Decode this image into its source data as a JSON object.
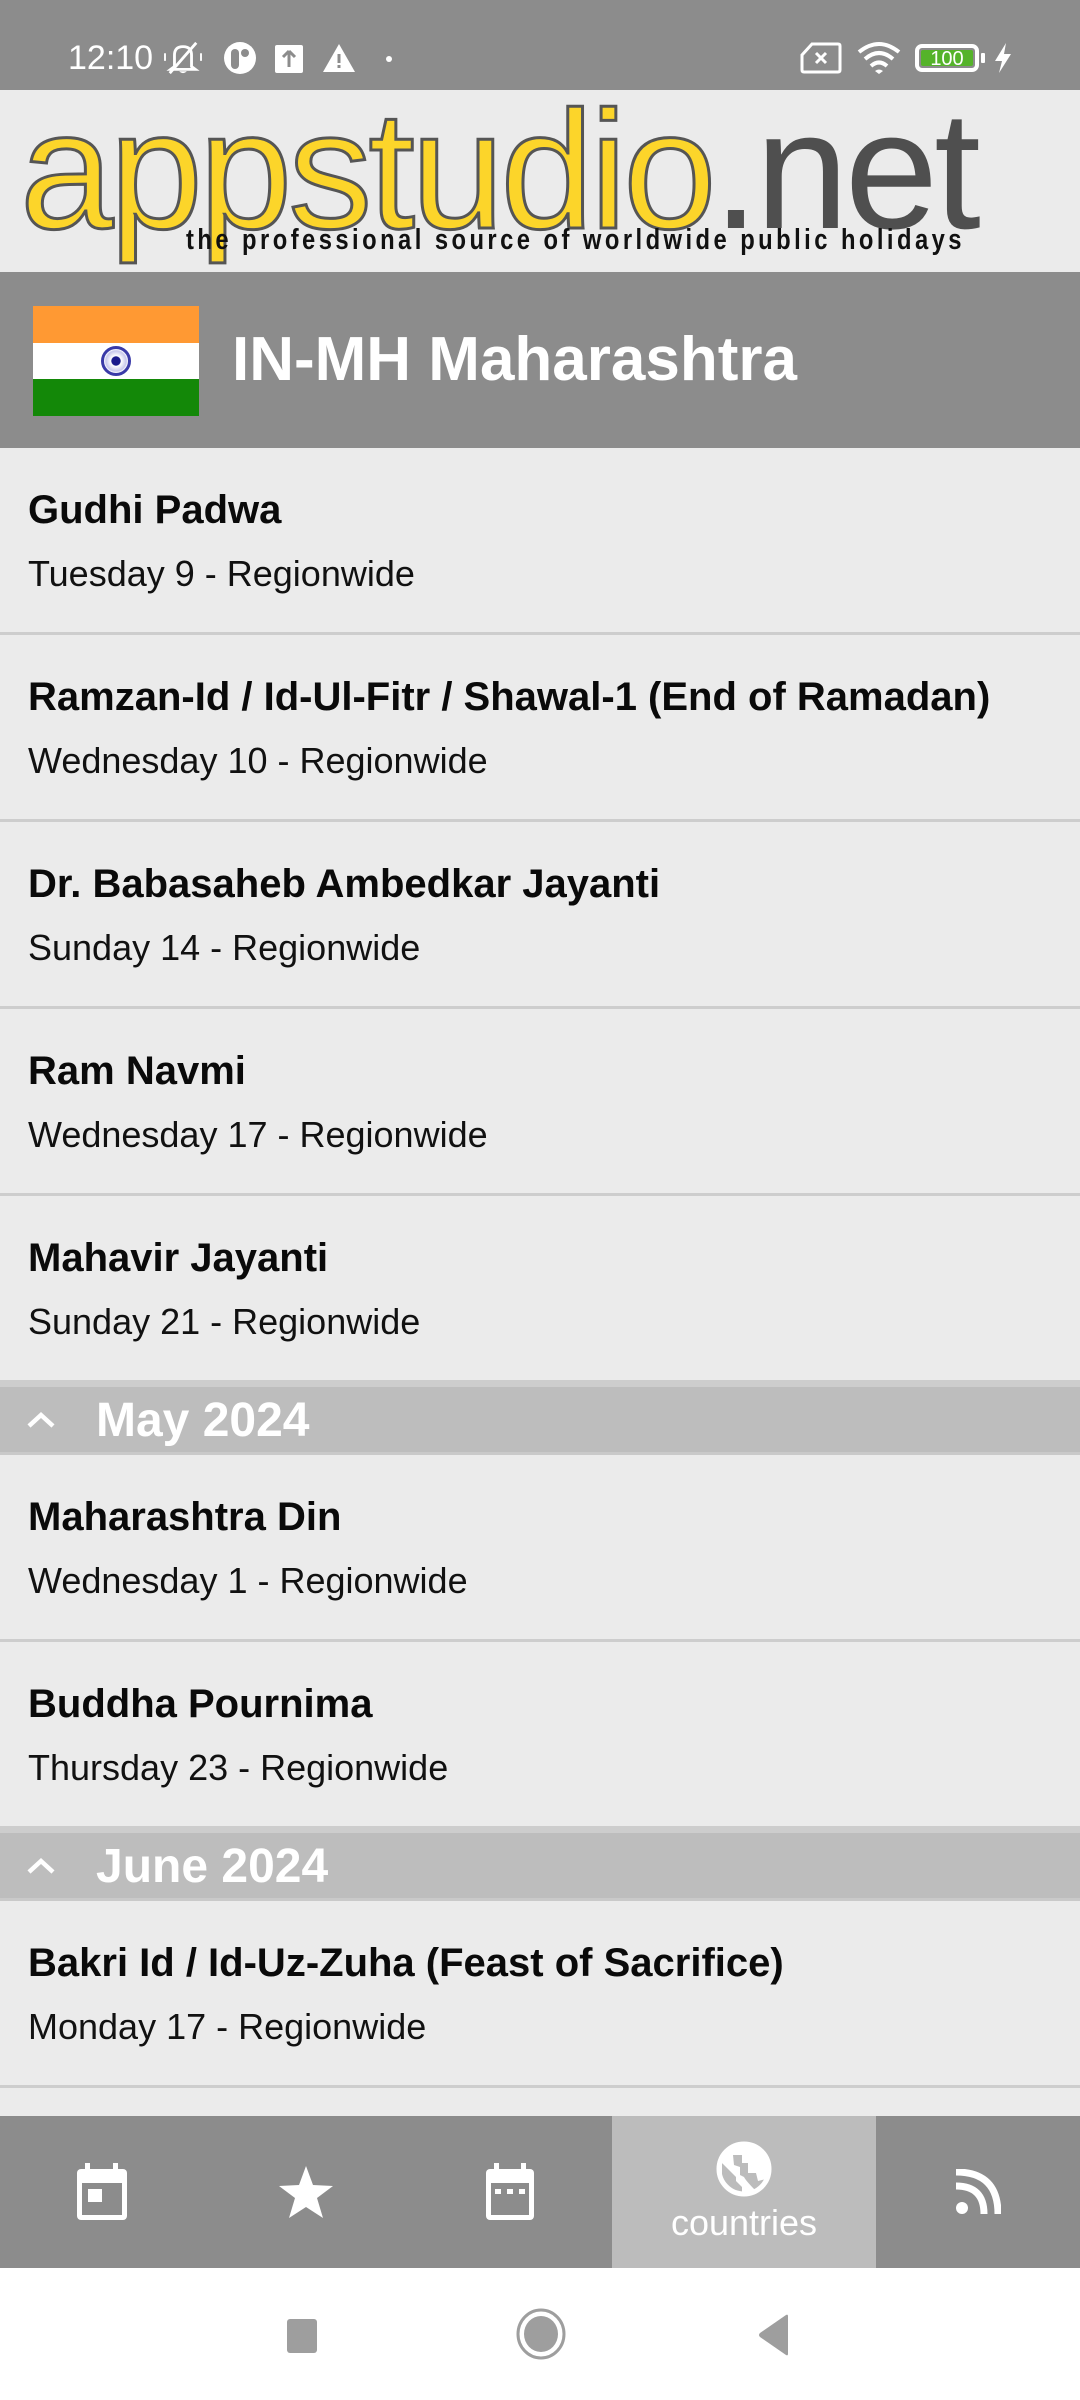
{
  "status_bar": {
    "time": "12:10",
    "battery_level": "100",
    "icons": [
      "bell-off-icon",
      "app-notification-icon",
      "upload-icon",
      "warning-icon",
      "dot-icon",
      "no-sim-icon",
      "wifi-icon",
      "battery-icon",
      "charging-icon"
    ]
  },
  "logo": {
    "brand_yellow": "appstudio",
    "brand_grey": ".net",
    "tagline": "the professional source of worldwide public holidays",
    "colors": {
      "yellow": "#fcd52a",
      "grey": "#4f4f4f"
    }
  },
  "region": {
    "flag": "india-flag",
    "title": "IN-MH Maharashtra"
  },
  "list": [
    {
      "type": "holiday",
      "title": "Gudhi Padwa",
      "subtitle": "Tuesday 9 - Regionwide"
    },
    {
      "type": "holiday",
      "title": "Ramzan-Id / Id-Ul-Fitr / Shawal-1 (End of Ramadan)",
      "subtitle": "Wednesday 10 - Regionwide"
    },
    {
      "type": "holiday",
      "title": "Dr. Babasaheb Ambedkar Jayanti",
      "subtitle": "Sunday 14 - Regionwide"
    },
    {
      "type": "holiday",
      "title": "Ram Navmi",
      "subtitle": "Wednesday 17 - Regionwide"
    },
    {
      "type": "holiday",
      "title": "Mahavir Jayanti",
      "subtitle": "Sunday 21 - Regionwide"
    },
    {
      "type": "month",
      "title": "May 2024"
    },
    {
      "type": "holiday",
      "title": "Maharashtra Din",
      "subtitle": "Wednesday 1 - Regionwide"
    },
    {
      "type": "holiday",
      "title": "Buddha Pournima",
      "subtitle": "Thursday 23 - Regionwide"
    },
    {
      "type": "month",
      "title": "June 2024"
    },
    {
      "type": "holiday",
      "title": "Bakri Id / Id-Uz-Zuha (Feast of Sacrifice)",
      "subtitle": "Monday 17 - Regionwide"
    }
  ],
  "bottom_nav": {
    "tabs": [
      {
        "icon": "calendar-today-icon",
        "label": ""
      },
      {
        "icon": "star-icon",
        "label": ""
      },
      {
        "icon": "calendar-month-icon",
        "label": ""
      },
      {
        "icon": "globe-icon",
        "label": "countries",
        "active": true
      },
      {
        "icon": "rss-feed-icon",
        "label": ""
      }
    ]
  },
  "system_nav": {
    "buttons": [
      "recents-button",
      "home-button",
      "back-button"
    ]
  },
  "colors": {
    "header_bg": "#8c8c8c",
    "list_bg": "#ebebeb",
    "month_bg": "#bdbdbd",
    "active_tab_bg": "#bcbcbc"
  }
}
